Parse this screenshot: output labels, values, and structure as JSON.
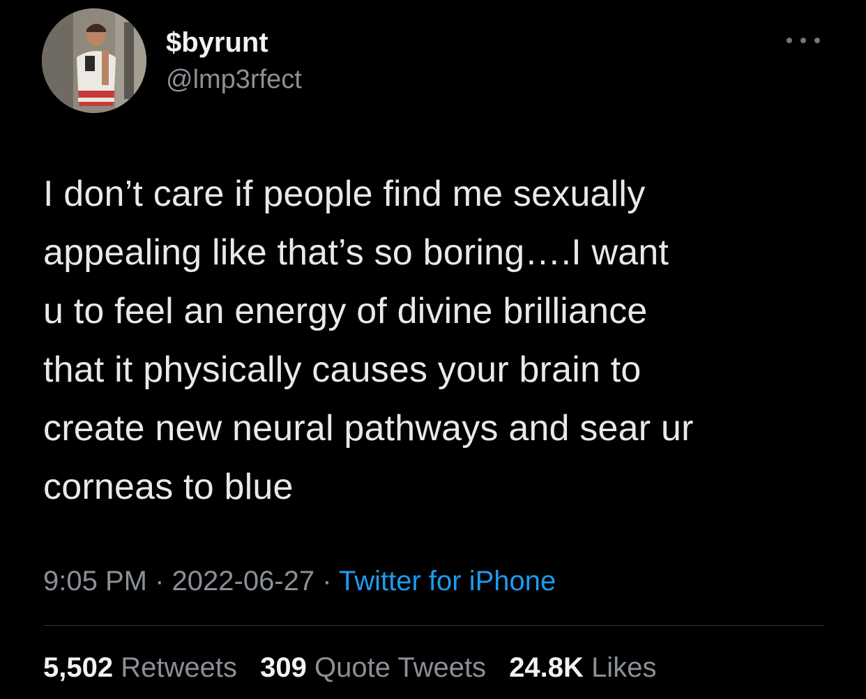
{
  "tweet": {
    "display_name": "$byrunt",
    "handle": "@lmp3rfect",
    "text": "I don’t care if people find me sexually\nappealing like that’s so boring….I want\nu to feel an energy of divine brilliance\nthat it physically causes your brain to\ncreate new neural pathways and sear ur\ncorneas to blue",
    "time": "9:05 PM",
    "separator": "·",
    "date": "2022-06-27",
    "source": "Twitter for iPhone"
  },
  "stats": {
    "retweets_count": "5,502",
    "retweets_label": "Retweets",
    "quotes_count": "309",
    "quotes_label": "Quote Tweets",
    "likes_count": "24.8K",
    "likes_label": "Likes"
  },
  "icons": {
    "more": "more-horizontal-icon",
    "avatar": "avatar-photo"
  },
  "colors": {
    "background": "#000000",
    "text": "#e7e9ea",
    "secondary": "#8b9097",
    "link": "#1d9bf0",
    "divider": "#2f3336"
  }
}
